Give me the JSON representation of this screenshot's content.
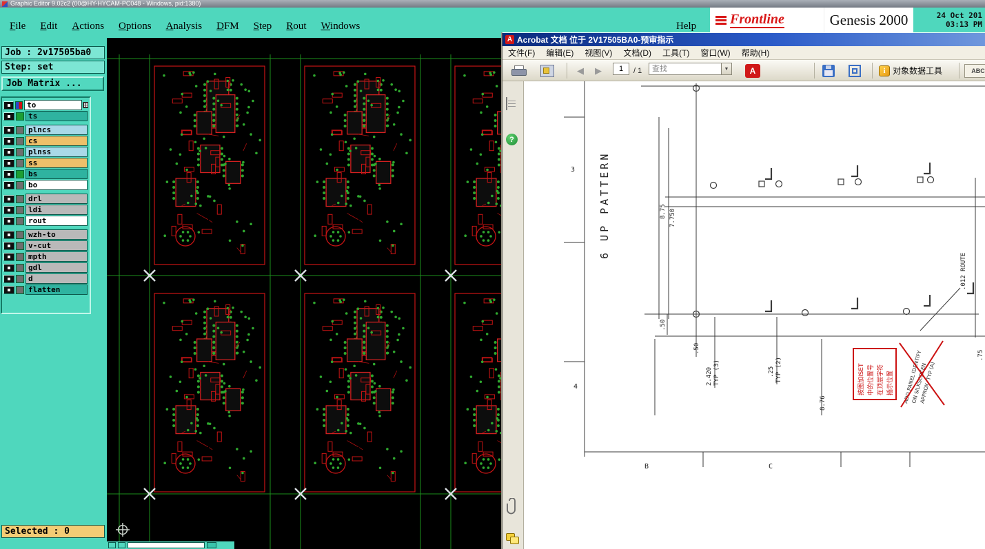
{
  "genesis": {
    "window_title": "Graphic Editor 9.02c2 (00@HY-HYCAM-PC048 - Windows, pid:1380)",
    "menu_items": [
      "File",
      "Edit",
      "Actions",
      "Options",
      "Analysis",
      "DFM",
      "Step",
      "Rout",
      "Windows"
    ],
    "help_label": "Help",
    "brand": {
      "logo_text": "Frontline",
      "product_name": "Genesis 2000",
      "date": "24 Oct 201",
      "time": "03:13 PM"
    },
    "job_label": "Job : 2v17505ba0",
    "step_label": "Step: set",
    "job_matrix_label": "Job Matrix ...",
    "selected_label": "Selected : 0",
    "layers": [
      {
        "name": "to",
        "box": "white",
        "chip": "#cc1111",
        "chip2": "#2a46c8"
      },
      {
        "name": "ts",
        "box": "teal",
        "chip": "#1d9e33"
      },
      {
        "name": "plncs",
        "box": "blue",
        "chip": "#6f6f6f",
        "gap_before": true
      },
      {
        "name": "cs",
        "box": "orange",
        "chip": "#6f6f6f"
      },
      {
        "name": "plnss",
        "box": "blue",
        "chip": "#6f6f6f"
      },
      {
        "name": "ss",
        "box": "orange",
        "chip": "#6f6f6f"
      },
      {
        "name": "bs",
        "box": "teal",
        "chip": "#1d9e33"
      },
      {
        "name": "bo",
        "box": "white",
        "chip": "#6f6f6f"
      },
      {
        "name": "drl",
        "box": "gray",
        "chip": "#6f6f6f",
        "gap_before": true
      },
      {
        "name": "ldi",
        "box": "gray",
        "chip": "#6f6f6f"
      },
      {
        "name": "rout",
        "box": "white",
        "chip": "#6f6f6f"
      },
      {
        "name": "wzh-to",
        "box": "gray",
        "chip": "#6f6f6f",
        "gap_before": true
      },
      {
        "name": "v-cut",
        "box": "gray",
        "chip": "#6f6f6f"
      },
      {
        "name": "mpth",
        "box": "gray",
        "chip": "#6f6f6f"
      },
      {
        "name": "gdl",
        "box": "gray",
        "chip": "#6f6f6f"
      },
      {
        "name": "d",
        "box": "gray",
        "chip": "#6f6f6f"
      },
      {
        "name": "flatten",
        "box": "teal",
        "chip": "#6f6f6f"
      }
    ]
  },
  "acrobat": {
    "window_title": "Acrobat 文档 位于 2V17505BA0-预审指示",
    "menu_items": [
      "文件(F)",
      "编辑(E)",
      "视图(V)",
      "文档(D)",
      "工具(T)",
      "窗口(W)",
      "帮助(H)"
    ],
    "toolbar": {
      "page_value": "1",
      "page_total": "/ 1",
      "find_placeholder": "查找",
      "object_data_label": "对象数据工具"
    },
    "icons": {
      "back_arrow": "◀",
      "forward_arrow": "▶",
      "dropdown_arrow": "▼",
      "help_glyph": "?",
      "info_glyph": "i",
      "pdf_glyph": "A",
      "abc_glyph": "ABC"
    },
    "drawing": {
      "pattern_title": "6 UP PATTERN",
      "dim_vertical_a": "8.75",
      "dim_vertical_b": "7.750",
      "dim_50_a": ".50",
      "dim_50_b": ".50",
      "dim_2420": "2.420",
      "dim_2420_typ": "TYP (3)",
      "dim_25": ".25",
      "dim_25_typ": "TYP (2)",
      "dim_876": "8.76",
      "dim_75": ".75",
      "route_label": ".012 ROUTE",
      "red_note_lines": [
        "按图加ISET",
        "中的位置号",
        "在顶层字符",
        "插示位置"
      ],
      "crossed_note_lines": [
        "ADD PANEL IDENTIFY",
        "ON SILKSCREEN",
        "APPROX. TYP (A)"
      ],
      "zone_left_a": "3",
      "zone_left_b": "4",
      "zone_bottom_a": "B",
      "zone_bottom_b": "C"
    }
  }
}
